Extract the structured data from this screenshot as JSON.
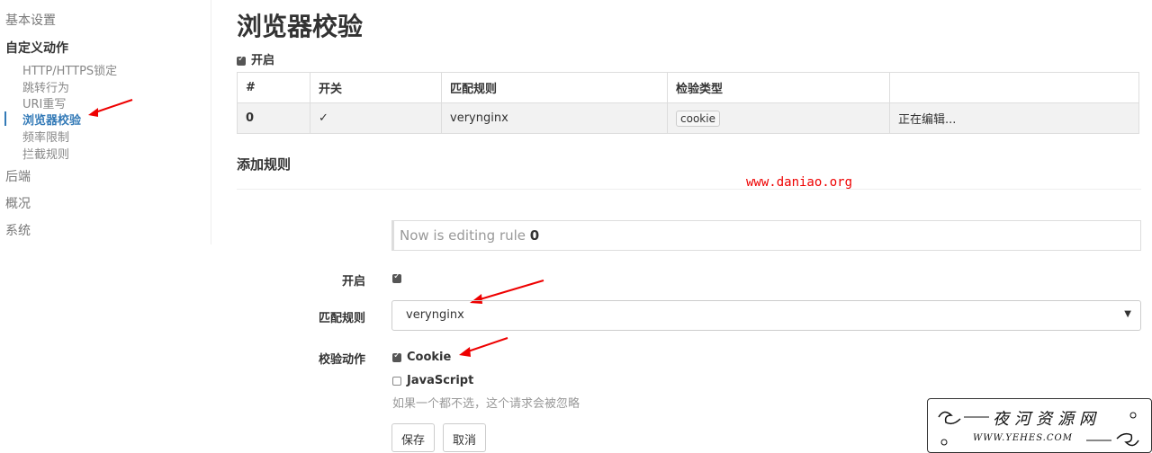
{
  "sidebar": {
    "items": [
      {
        "label": "基本设置"
      },
      {
        "label": "自定义动作"
      },
      {
        "label": "后端"
      },
      {
        "label": "概况"
      },
      {
        "label": "系统"
      }
    ],
    "sub_items": [
      {
        "label": "HTTP/HTTPS锁定"
      },
      {
        "label": "跳转行为"
      },
      {
        "label": "URI重写"
      },
      {
        "label": "浏览器校验"
      },
      {
        "label": "频率限制"
      },
      {
        "label": "拦截规则"
      }
    ]
  },
  "main": {
    "title": "浏览器校验",
    "enable_label": "开启",
    "table": {
      "headers": [
        "#",
        "开关",
        "匹配规则",
        "检验类型",
        ""
      ],
      "rows": [
        {
          "index": "0",
          "switch": "✓",
          "rule": "verynginx",
          "type": "cookie",
          "status": "正在编辑..."
        }
      ]
    },
    "add_rule_title": "添加规则",
    "watermark_url": "www.daniao.org",
    "editing_prefix": "Now is editing rule ",
    "editing_rule_no": "0",
    "form": {
      "enable_label": "开启",
      "match_label": "匹配规则",
      "match_value": "verynginx",
      "action_label": "校验动作",
      "opt_cookie": "Cookie",
      "opt_js": "JavaScript",
      "hint": "如果一个都不选，这个请求会被忽略",
      "save": "保存",
      "cancel": "取消"
    }
  },
  "logo": {
    "title": "夜河资源网",
    "url": "WWW.YEHES.COM"
  },
  "colors": {
    "accent": "#337ab7",
    "arrow": "#e00000"
  }
}
